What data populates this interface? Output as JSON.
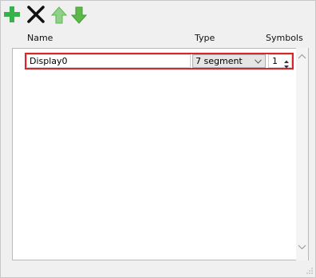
{
  "toolbar": {
    "add_icon": "plus-icon",
    "delete_icon": "x-icon",
    "up_icon": "arrow-up-icon",
    "down_icon": "arrow-down-icon"
  },
  "table": {
    "columns": [
      "Name",
      "Type",
      "Symbols"
    ],
    "rows": [
      {
        "name": "Display0",
        "type": "7 segment",
        "symbols": "1"
      }
    ]
  },
  "colors": {
    "add": "#36b24a",
    "arrows": "#5db84a",
    "highlight": "#d9262c"
  }
}
